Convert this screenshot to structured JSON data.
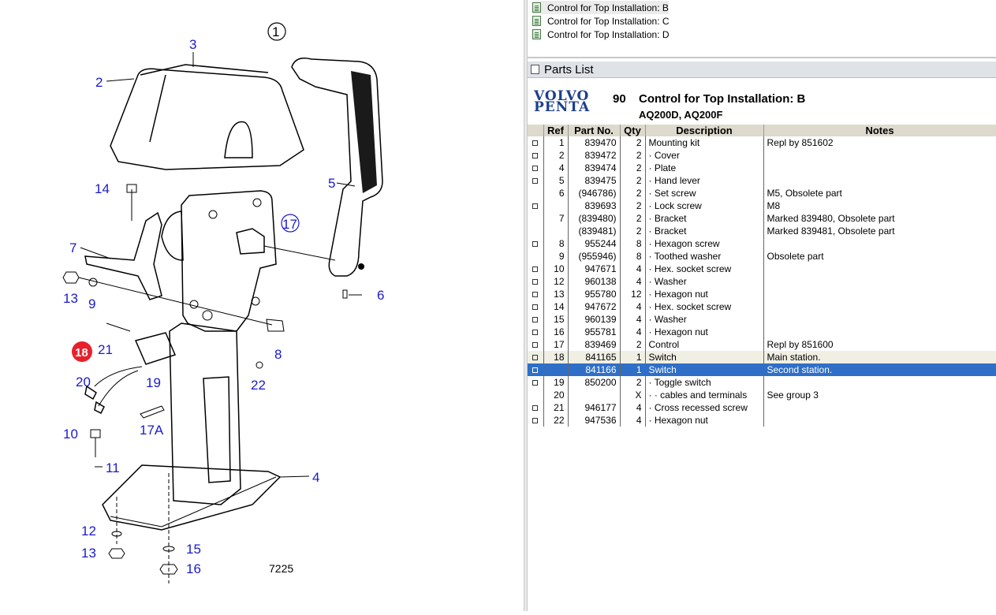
{
  "tree": {
    "items": [
      {
        "label": "Control for Top Installation: B",
        "selected": true
      },
      {
        "label": "Control for Top Installation: C",
        "selected": false
      },
      {
        "label": "Control for Top Installation: D",
        "selected": false
      }
    ]
  },
  "panel": {
    "title": "Parts List"
  },
  "header": {
    "logo_line1": "VOLVO",
    "logo_line2": "PENTA",
    "group": "90",
    "title": "Control for Top Installation: B",
    "subtitle": "AQ200D, AQ200F"
  },
  "table": {
    "columns": [
      "Ref",
      "Part No.",
      "Qty",
      "Description",
      "Notes"
    ],
    "rows": [
      {
        "chk": true,
        "ref": "1",
        "part": "839470",
        "qty": "2",
        "desc": "Mounting kit",
        "notes": "Repl by 851602"
      },
      {
        "chk": true,
        "ref": "2",
        "part": "839472",
        "qty": "2",
        "desc": "· Cover",
        "notes": ""
      },
      {
        "chk": true,
        "ref": "4",
        "part": "839474",
        "qty": "2",
        "desc": "· Plate",
        "notes": ""
      },
      {
        "chk": true,
        "ref": "5",
        "part": "839475",
        "qty": "2",
        "desc": "· Hand lever",
        "notes": ""
      },
      {
        "chk": false,
        "ref": "6",
        "part": "(946786)",
        "qty": "2",
        "desc": "· Set screw",
        "notes": "M5, Obsolete part"
      },
      {
        "chk": true,
        "ref": "",
        "part": "839693",
        "qty": "2",
        "desc": "· Lock screw",
        "notes": "M8"
      },
      {
        "chk": false,
        "ref": "7",
        "part": "(839480)",
        "qty": "2",
        "desc": "· Bracket",
        "notes": "Marked 839480, Obsolete part"
      },
      {
        "chk": false,
        "ref": "",
        "part": "(839481)",
        "qty": "2",
        "desc": "· Bracket",
        "notes": "Marked 839481, Obsolete part"
      },
      {
        "chk": true,
        "ref": "8",
        "part": "955244",
        "qty": "8",
        "desc": "· Hexagon screw",
        "notes": ""
      },
      {
        "chk": false,
        "ref": "9",
        "part": "(955946)",
        "qty": "8",
        "desc": "· Toothed washer",
        "notes": "Obsolete part"
      },
      {
        "chk": true,
        "ref": "10",
        "part": "947671",
        "qty": "4",
        "desc": "· Hex. socket screw",
        "notes": ""
      },
      {
        "chk": true,
        "ref": "12",
        "part": "960138",
        "qty": "4",
        "desc": "· Washer",
        "notes": ""
      },
      {
        "chk": true,
        "ref": "13",
        "part": "955780",
        "qty": "12",
        "desc": "· Hexagon nut",
        "notes": ""
      },
      {
        "chk": true,
        "ref": "14",
        "part": "947672",
        "qty": "4",
        "desc": "· Hex. socket screw",
        "notes": ""
      },
      {
        "chk": true,
        "ref": "15",
        "part": "960139",
        "qty": "4",
        "desc": "· Washer",
        "notes": ""
      },
      {
        "chk": true,
        "ref": "16",
        "part": "955781",
        "qty": "4",
        "desc": "· Hexagon nut",
        "notes": ""
      },
      {
        "chk": true,
        "ref": "17",
        "part": "839469",
        "qty": "2",
        "desc": "Control",
        "notes": "Repl by 851600"
      },
      {
        "chk": true,
        "ref": "18",
        "part": "841165",
        "qty": "1",
        "desc": "Switch",
        "notes": "Main station.",
        "state": "hl"
      },
      {
        "chk": true,
        "ref": "",
        "part": "841166",
        "qty": "1",
        "desc": "Switch",
        "notes": "Second station.",
        "state": "sel"
      },
      {
        "chk": true,
        "ref": "19",
        "part": "850200",
        "qty": "2",
        "desc": "· Toggle switch",
        "notes": ""
      },
      {
        "chk": false,
        "ref": "20",
        "part": "",
        "qty": "X",
        "desc": "· · cables and terminals",
        "notes": "See group 3"
      },
      {
        "chk": true,
        "ref": "21",
        "part": "946177",
        "qty": "4",
        "desc": "· Cross recessed screw",
        "notes": ""
      },
      {
        "chk": true,
        "ref": "22",
        "part": "947536",
        "qty": "4",
        "desc": "· Hexagon nut",
        "notes": ""
      }
    ]
  },
  "diagram": {
    "callouts": [
      "1",
      "2",
      "3",
      "4",
      "5",
      "6",
      "7",
      "8",
      "9",
      "10",
      "11",
      "12",
      "13",
      "13",
      "14",
      "15",
      "16",
      "17",
      "17A",
      "18",
      "19",
      "20",
      "21",
      "22"
    ],
    "drawing_number": "7225",
    "highlight_color": "#e8202a",
    "label_color": "#1a1acc"
  }
}
